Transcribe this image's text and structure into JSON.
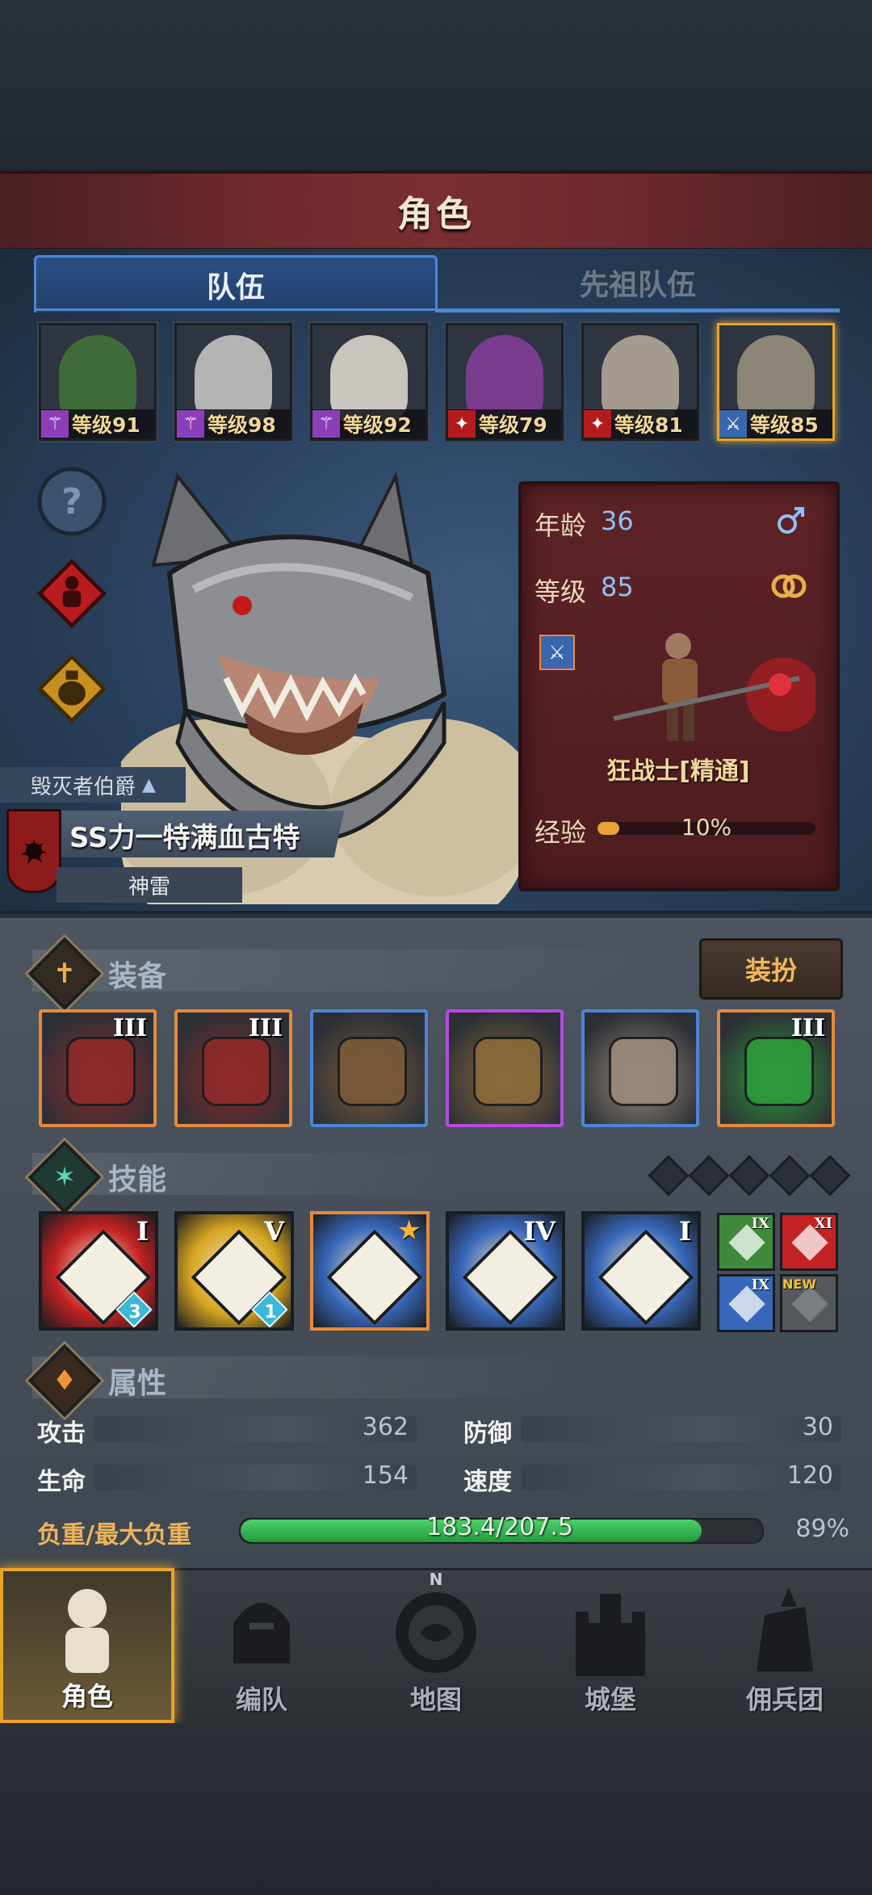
{
  "header": {
    "title": "角色"
  },
  "tabs": [
    {
      "label": "队伍"
    },
    {
      "label": "先祖队伍"
    }
  ],
  "party": [
    {
      "level": "等级91",
      "class_icon": "staff-icon",
      "class_color": "#8a3fb8",
      "face": "#3f6b3a"
    },
    {
      "level": "等级98",
      "class_icon": "staff-icon",
      "class_color": "#8a3fb8",
      "face": "#b4b4b4"
    },
    {
      "level": "等级92",
      "class_icon": "staff-icon",
      "class_color": "#8a3fb8",
      "face": "#c9c4bd"
    },
    {
      "level": "等级79",
      "class_icon": "beast-icon",
      "class_color": "#b31c1c",
      "face": "#7a3c8f"
    },
    {
      "level": "等级81",
      "class_icon": "beast-icon",
      "class_color": "#b31c1c",
      "face": "#a49a90"
    },
    {
      "level": "等级85",
      "class_icon": "sword-icon",
      "class_color": "#3a66b0",
      "face": "#8c8578"
    }
  ],
  "hero": {
    "title_tag": "毁灭者伯爵",
    "name": "SS力一特满血古特",
    "sub": "神雷"
  },
  "info": {
    "age_label": "年龄",
    "age": "36",
    "level_label": "等级",
    "level": "85",
    "class_name": "狂战士[精通]",
    "exp_label": "经验",
    "exp_text": "10%",
    "exp_progress": 0.1
  },
  "equipment": {
    "title": "装备",
    "outfit_button": "装扮",
    "items": [
      {
        "name": "heavy-weapon",
        "rank": "III",
        "border": "#e58a3a",
        "color": "#8d2a2a"
      },
      {
        "name": "heavy-weapon-2",
        "rank": "III",
        "border": "#e58a3a",
        "color": "#8d2a2a"
      },
      {
        "name": "helmet",
        "rank": "",
        "border": "#4b86d4",
        "color": "#7a5a3a"
      },
      {
        "name": "armor",
        "rank": "",
        "border": "#b34be0",
        "color": "#8a6a3a"
      },
      {
        "name": "boots",
        "rank": "",
        "border": "#4b86d4",
        "color": "#9b8a7a"
      },
      {
        "name": "trinket",
        "rank": "III",
        "border": "#e58a3a",
        "color": "#2e9a3a"
      }
    ]
  },
  "skills": {
    "title": "技能",
    "items": [
      {
        "rank": "I",
        "gem": "3",
        "bg": "#c22222",
        "border": "#1a1c20"
      },
      {
        "rank": "V",
        "gem": "1",
        "bg": "#d6a520",
        "border": "#1a1c20"
      },
      {
        "rank": "",
        "gem": "",
        "bg": "#3767b8",
        "border": "#e58a3a",
        "star": true
      },
      {
        "rank": "IV",
        "gem": "",
        "bg": "#3767b8",
        "border": "#1a1c20"
      },
      {
        "rank": "I",
        "gem": "",
        "bg": "#3767b8",
        "border": "#1a1c20"
      }
    ],
    "mini": [
      {
        "rank": "IX",
        "bg": "#3f8a3a"
      },
      {
        "rank": "XI",
        "bg": "#c22222"
      },
      {
        "rank": "IX",
        "bg": "#3767b8"
      },
      {
        "rank": "",
        "bg": "#55595e",
        "badge": "NEW"
      }
    ]
  },
  "attributes": {
    "title": "属性",
    "attack_label": "攻击",
    "attack": "362",
    "defense_label": "防御",
    "defense": "30",
    "hp_label": "生命",
    "hp": "154",
    "speed_label": "速度",
    "speed": "120",
    "load_label": "负重/最大负重",
    "load_text": "183.4/207.5",
    "load_pct": "89%",
    "load_progress": 0.884
  },
  "nav": [
    {
      "label": "角色",
      "icon": "knight-icon",
      "active": true
    },
    {
      "label": "编队",
      "icon": "helmet-icon",
      "active": false
    },
    {
      "label": "地图",
      "icon": "compass-icon",
      "active": false,
      "mark": "N"
    },
    {
      "label": "城堡",
      "icon": "castle-icon",
      "active": false
    },
    {
      "label": "佣兵团",
      "icon": "mercenary-icon",
      "active": false
    }
  ]
}
